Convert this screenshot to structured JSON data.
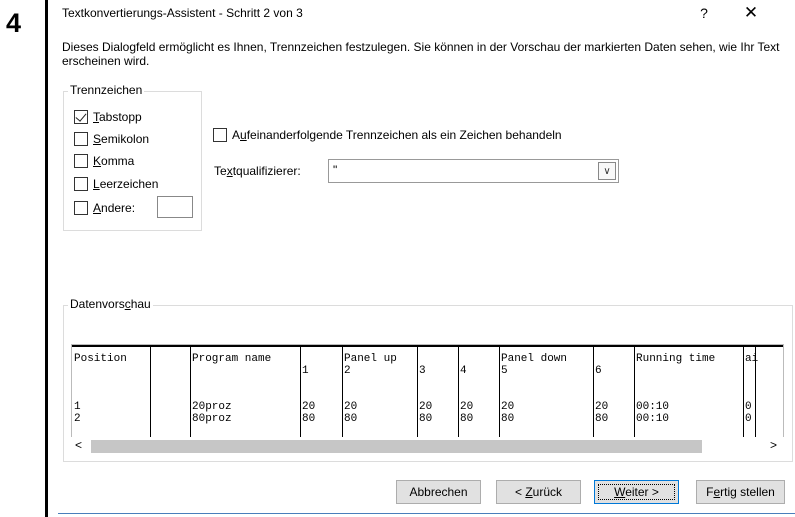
{
  "step_number": "4",
  "dialog": {
    "title": "Textkonvertierungs-Assistent - Schritt 2 von 3",
    "help_glyph": "?",
    "close_glyph": "✕",
    "description": "Dieses Dialogfeld ermöglicht es Ihnen, Trennzeichen festzulegen. Sie können in der Vorschau der markierten Daten sehen, wie Ihr Text erscheinen wird."
  },
  "delimiters": {
    "group_label": "Trennzeichen",
    "tab": {
      "hotkey": "T",
      "rest": "abstopp",
      "checked": true
    },
    "semicolon": {
      "hotkey": "S",
      "rest": "emikolon",
      "checked": false
    },
    "comma": {
      "hotkey": "K",
      "rest": "omma",
      "checked": false
    },
    "space": {
      "hotkey": "L",
      "rest": "eerzeichen",
      "checked": false
    },
    "other": {
      "hotkey": "A",
      "rest": "ndere:",
      "checked": false,
      "value": ""
    }
  },
  "consecutive": {
    "pre": "A",
    "hotkey": "u",
    "post": "feinanderfolgende Trennzeichen als ein Zeichen behandeln",
    "checked": false
  },
  "text_qualifier": {
    "pre": "Te",
    "hotkey": "x",
    "post": "tqualifizierer:",
    "value": "\""
  },
  "preview": {
    "group_pre": "Datenvors",
    "group_hotkey": "c",
    "group_post": "hau",
    "row1": [
      "Position",
      "",
      "Program name",
      "",
      "Panel up",
      "",
      "",
      "Panel down",
      "",
      "Running time",
      "ai"
    ],
    "row2": [
      "",
      "",
      "",
      "1",
      "2",
      "3",
      "4",
      "5",
      "6",
      "",
      ""
    ],
    "row3": [
      "1",
      "",
      "20proz",
      "20",
      "20",
      "20",
      "20",
      "20",
      "20",
      "00:10",
      "0"
    ],
    "row4": [
      "2",
      "",
      "80proz",
      "80",
      "80",
      "80",
      "80",
      "80",
      "80",
      "00:10",
      "0"
    ]
  },
  "scroll": {
    "up": "^",
    "down": "v",
    "left": "<",
    "right": ">"
  },
  "buttons": {
    "cancel": "Abbrechen",
    "back_pre": "< ",
    "back_hotkey": "Z",
    "back_post": "urück",
    "next_hotkey": "W",
    "next_post": "eiter >",
    "finish_pre": "F",
    "finish_hotkey": "e",
    "finish_post": "rtig stellen"
  }
}
